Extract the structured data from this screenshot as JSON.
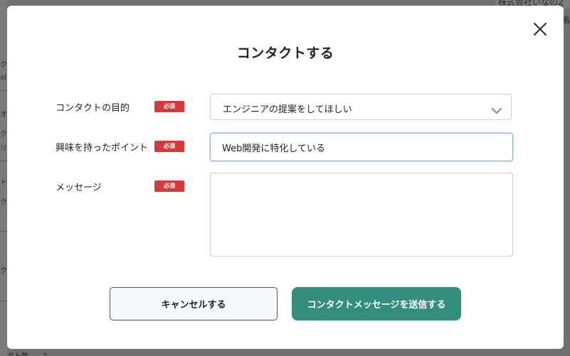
{
  "background": {
    "top_right_text": "株式会社いなの2",
    "top_right_text2": "島",
    "bottom_left_text": "タト数　　7",
    "left_fragments": [
      "ク",
      "al",
      "オ",
      "ク",
      "リ",
      "ト",
      "ク",
      "ク"
    ]
  },
  "modal": {
    "title": "コンタクトする",
    "close_label": "×",
    "fields": {
      "purpose": {
        "label": "コンタクトの目的",
        "required_badge": "必須",
        "selected_value": "エンジニアの提案をしてほしい"
      },
      "interest": {
        "label": "興味を持ったポイント",
        "required_badge": "必須",
        "value": "Web開発に特化している"
      },
      "message": {
        "label": "メッセージ",
        "required_badge": "必須",
        "value": ""
      }
    },
    "buttons": {
      "cancel_label": "キャンセルする",
      "submit_label": "コンタクトメッセージを送信する"
    }
  },
  "colors": {
    "required_badge": "#d7393a",
    "submit_button": "#338f7c",
    "backdrop": "#6f6f6f"
  },
  "icons": {
    "close": "close-icon",
    "dropdown": "chevron-down-icon"
  }
}
